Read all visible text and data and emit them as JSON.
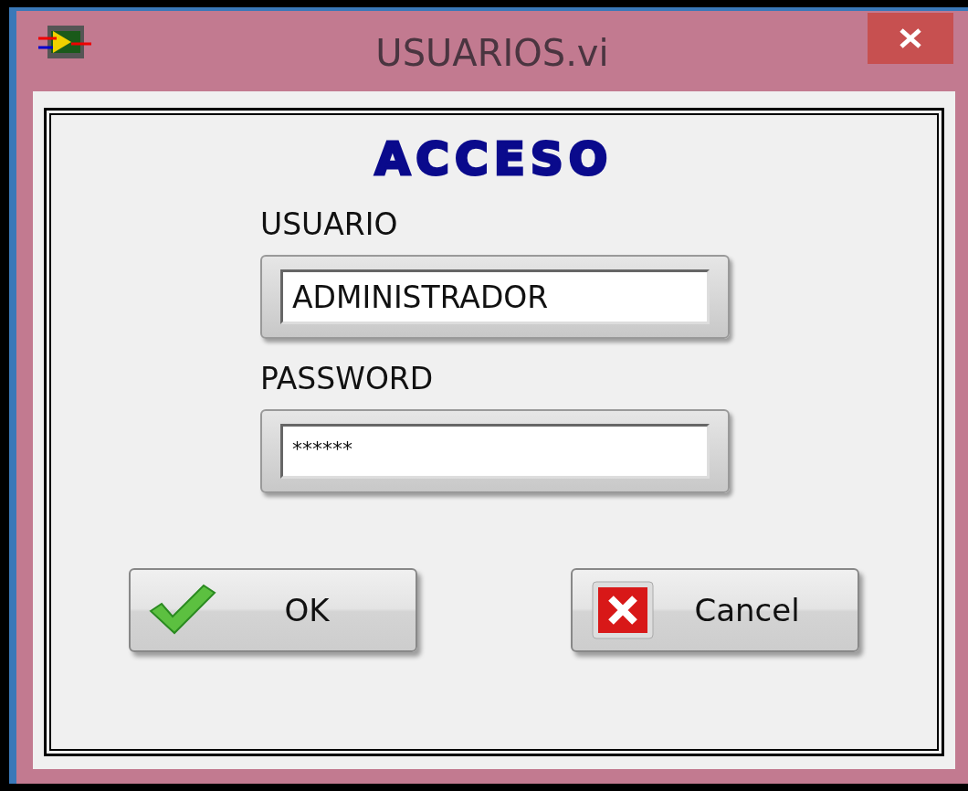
{
  "window": {
    "title": "USUARIOS.vi"
  },
  "heading": "ACCESO",
  "fields": [
    {
      "label": "USUARIO",
      "value": "ADMINISTRADOR",
      "kind": "text"
    },
    {
      "label": "PASSWORD",
      "value": "******",
      "kind": "password"
    }
  ],
  "buttons": [
    {
      "label": "OK",
      "kind": "ok"
    },
    {
      "label": "Cancel",
      "kind": "cancel"
    }
  ]
}
